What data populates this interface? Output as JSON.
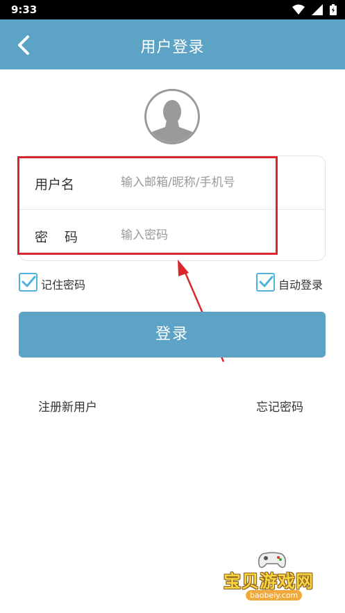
{
  "status_bar": {
    "time": "9:33",
    "icons": [
      "wifi-icon",
      "signal-icon",
      "battery-icon"
    ]
  },
  "app_bar": {
    "title": "用户登录",
    "back_icon": "back-arrow-icon"
  },
  "avatar": {
    "icon": "user-avatar-icon"
  },
  "form": {
    "username": {
      "label": "用户名",
      "placeholder": "输入邮箱/昵称/手机号",
      "value": ""
    },
    "password": {
      "label": "密码",
      "placeholder": "输入密码",
      "value": ""
    }
  },
  "options": {
    "remember_password": {
      "label": "记住密码",
      "checked": true
    },
    "auto_login": {
      "label": "自动登录",
      "checked": true
    }
  },
  "login_button": {
    "label": "登录"
  },
  "links": {
    "register": "注册新用户",
    "forgot_password": "忘记密码"
  },
  "watermark": {
    "text": "宝贝游戏网",
    "url": "baobeiy.com"
  },
  "colors": {
    "primary": "#5ca3c5",
    "checkbox": "#4fb2dd",
    "annotation": "#d9262c",
    "text": "#333333",
    "placeholder": "#9a9a9a"
  }
}
